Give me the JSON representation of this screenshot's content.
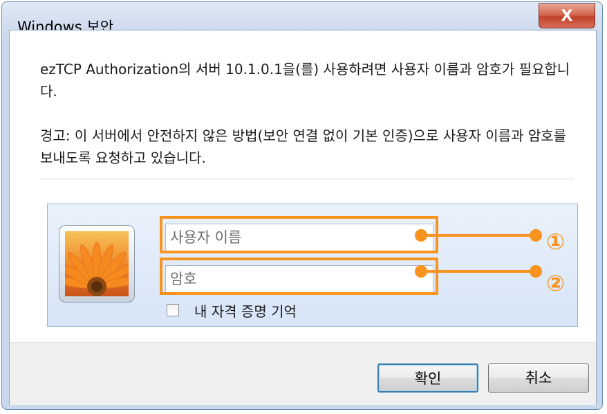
{
  "window": {
    "title": "Windows 보안",
    "close_glyph": "X"
  },
  "message": {
    "line1": "ezTCP Authorization의 서버 10.1.0.1을(를) 사용하려면 사용자 이름과 암호가 필요합니다.",
    "line2": "경고: 이 서버에서 안전하지 않은 방법(보안 연결 없이 기본 인증)으로 사용자 이름과 암호를 보내도록 요청하고 있습니다."
  },
  "credentials": {
    "avatar_icon": "user-tile-flower-icon",
    "username_placeholder": "사용자 이름",
    "username_value": "",
    "password_placeholder": "암호",
    "password_value": "",
    "remember_label": "내 자격 증명 기억",
    "remember_checked": false
  },
  "buttons": {
    "ok_label": "확인",
    "cancel_label": "취소"
  },
  "annotations": {
    "color": "#f7931e",
    "callout_1": "①",
    "callout_2": "②"
  }
}
